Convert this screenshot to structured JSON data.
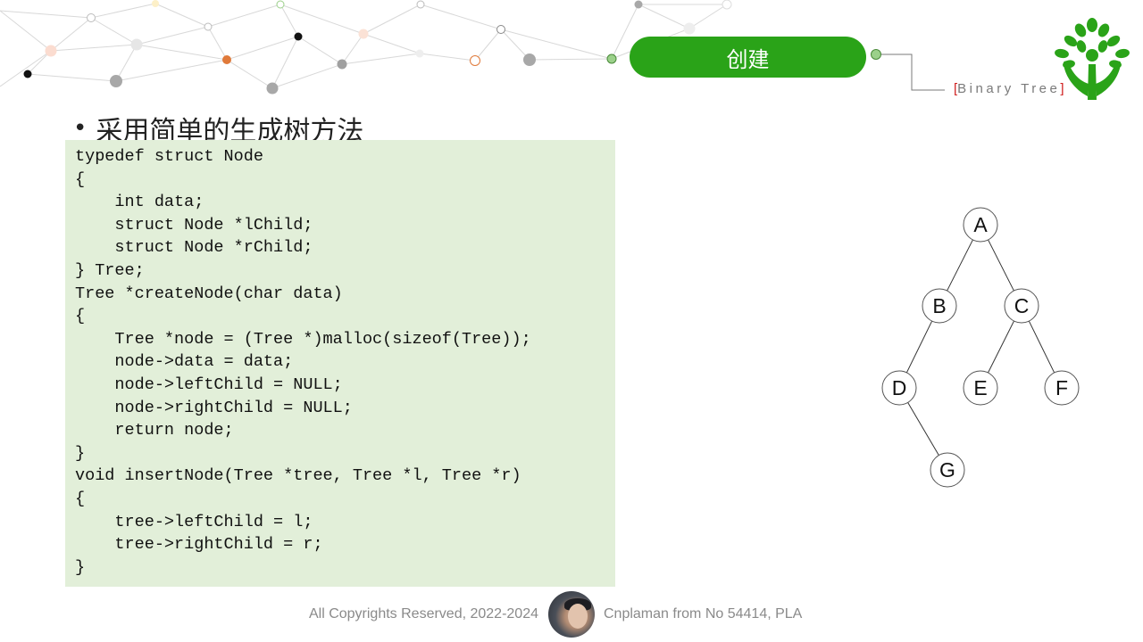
{
  "header": {
    "title": "创建",
    "subtitle_bracket_open": "[",
    "subtitle_text": "Binary Tree",
    "subtitle_bracket_close": "]",
    "accent_color": "#2aa318",
    "bracket_color": "#d02020",
    "logo_icon": "tree-hands-icon"
  },
  "content": {
    "bullet": "•",
    "heading": "采用简单的生成树方法",
    "code_lines": [
      "typedef struct Node",
      "{",
      "    int data;",
      "    struct Node *lChild;",
      "    struct Node *rChild;",
      "} Tree;",
      "Tree *createNode(char data)",
      "{",
      "    Tree *node = (Tree *)malloc(sizeof(Tree));",
      "    node->data = data;",
      "    node->leftChild = NULL;",
      "    node->rightChild = NULL;",
      "    return node;",
      "}",
      "void insertNode(Tree *tree, Tree *l, Tree *r)",
      "{",
      "    tree->leftChild = l;",
      "    tree->rightChild = r;",
      "}"
    ],
    "code_background": "#e2efd9"
  },
  "tree": {
    "nodes": [
      "A",
      "B",
      "C",
      "D",
      "E",
      "F",
      "G"
    ],
    "edges": [
      [
        "A",
        "B"
      ],
      [
        "A",
        "C"
      ],
      [
        "B",
        "D"
      ],
      [
        "C",
        "E"
      ],
      [
        "C",
        "F"
      ],
      [
        "D",
        "G"
      ]
    ]
  },
  "footer": {
    "left": "All Copyrights Reserved, 2022-2024",
    "right": "Cnplaman from No 54414, PLA",
    "avatar_icon": "author-avatar"
  }
}
